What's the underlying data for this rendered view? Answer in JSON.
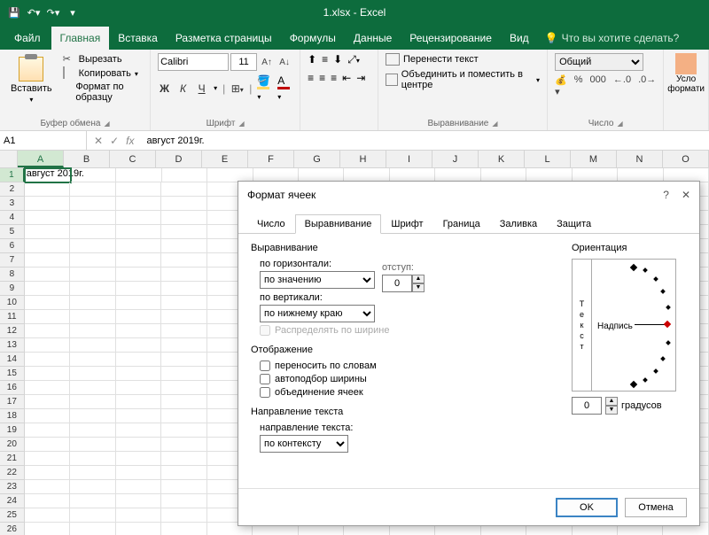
{
  "titlebar": {
    "doc_title": "1.xlsx - Excel"
  },
  "menu": {
    "file": "Файл",
    "tabs": [
      "Главная",
      "Вставка",
      "Разметка страницы",
      "Формулы",
      "Данные",
      "Рецензирование",
      "Вид"
    ],
    "tell_me": "Что вы хотите сделать?"
  },
  "ribbon": {
    "clipboard": {
      "paste": "Вставить",
      "cut": "Вырезать",
      "copy": "Копировать",
      "format_painter": "Формат по образцу",
      "group": "Буфер обмена"
    },
    "font": {
      "name": "Calibri",
      "size": "11",
      "group": "Шрифт",
      "buttons": {
        "bold": "Ж",
        "italic": "К",
        "underline": "Ч"
      }
    },
    "alignment": {
      "wrap": "Перенести текст",
      "merge": "Объединить и поместить в центре",
      "group": "Выравнивание"
    },
    "number": {
      "format": "Общий",
      "group": "Число"
    },
    "styles": {
      "cond": "Усло",
      "fmt": "формати"
    }
  },
  "formulabar": {
    "namebox": "A1",
    "formula": "август 2019г."
  },
  "grid": {
    "columns": [
      "A",
      "B",
      "C",
      "D",
      "E",
      "F",
      "G",
      "H",
      "I",
      "J",
      "K",
      "L",
      "M",
      "N",
      "O"
    ],
    "rows_count": 26,
    "a1_value": "август 2019г."
  },
  "dialog": {
    "title": "Формат ячеек",
    "tabs": [
      "Число",
      "Выравнивание",
      "Шрифт",
      "Граница",
      "Заливка",
      "Защита"
    ],
    "active_tab": 1,
    "alignment": {
      "section": "Выравнивание",
      "horizontal_label": "по горизонтали:",
      "horizontal_value": "по значению",
      "vertical_label": "по вертикали:",
      "vertical_value": "по нижнему краю",
      "distribute": "Распределять по ширине",
      "indent_label": "отступ:",
      "indent_value": "0"
    },
    "display": {
      "section": "Отображение",
      "wrap": "переносить по словам",
      "shrink": "автоподбор ширины",
      "merge": "объединение ячеек"
    },
    "text_direction": {
      "section": "Направление текста",
      "label": "направление текста:",
      "value": "по контексту"
    },
    "orientation": {
      "section": "Ориентация",
      "vertical_text": "Текст",
      "nadpis": "Надпись",
      "degrees_value": "0",
      "degrees_label": "градусов"
    },
    "buttons": {
      "ok": "OK",
      "cancel": "Отмена"
    }
  }
}
